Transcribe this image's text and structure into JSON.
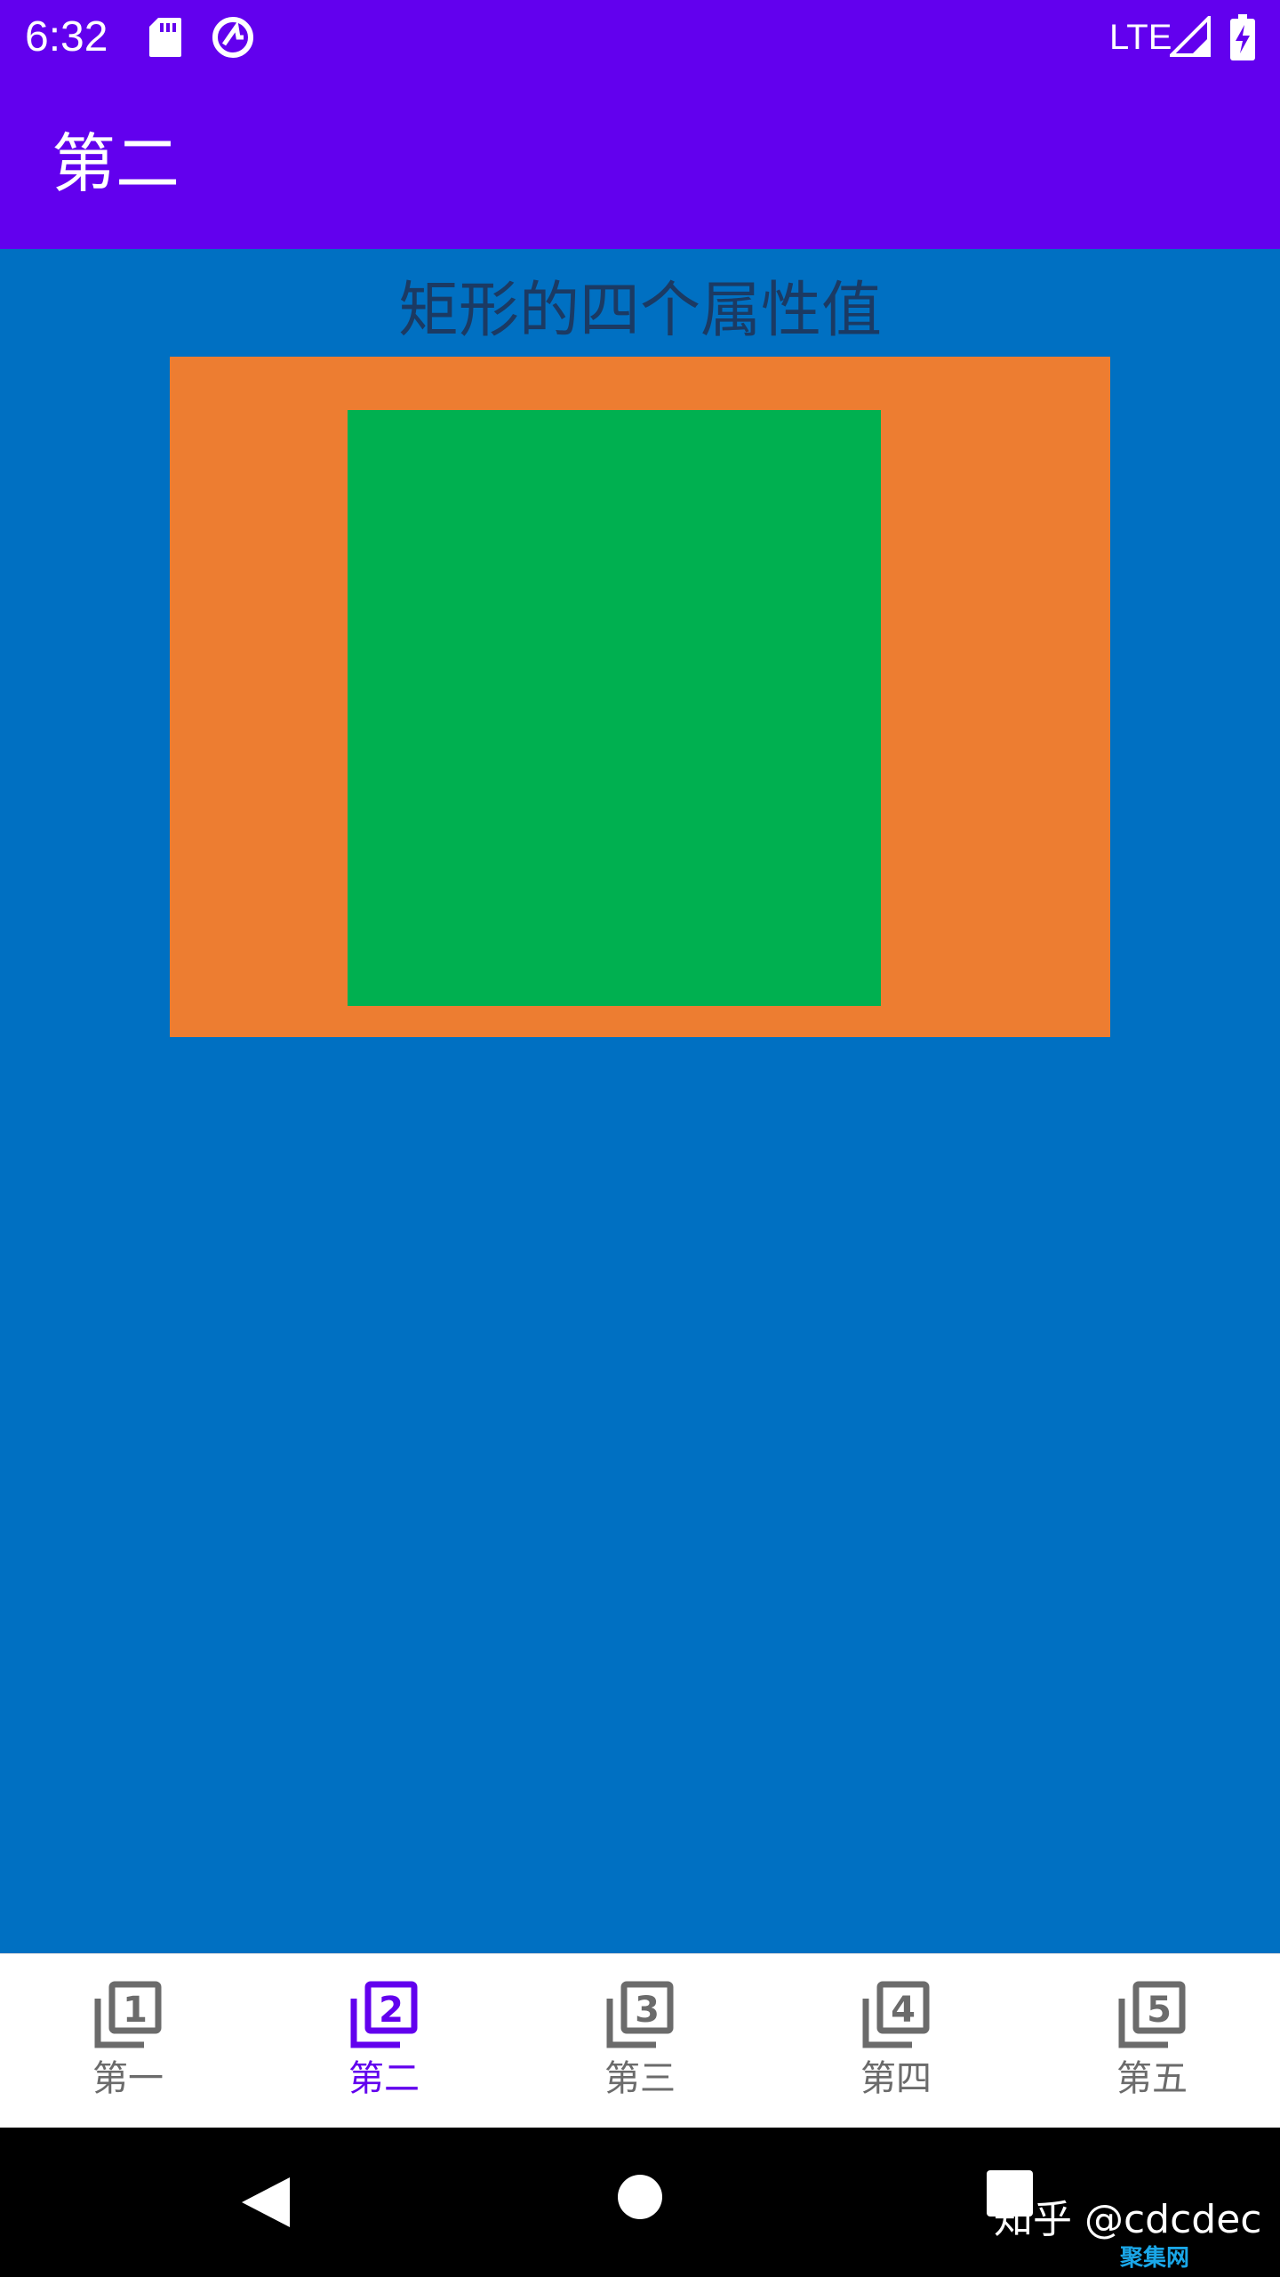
{
  "status_bar": {
    "time": "6:32",
    "network": "LTE",
    "icons": [
      "sd-card-icon",
      "sync-icon",
      "signal-icon",
      "battery-charging-icon"
    ]
  },
  "app_bar": {
    "title": "第二"
  },
  "content": {
    "heading": "矩形的四个属性值",
    "colors": {
      "background": "#0070C2",
      "outer_rect": "#ED7D31",
      "inner_rect": "#00B050"
    }
  },
  "bottom_nav": {
    "active_index": 1,
    "active_color": "#6200EE",
    "inactive_color": "#6B6B6B",
    "items": [
      {
        "label": "第一",
        "icon": "filter-1-icon",
        "number": "1"
      },
      {
        "label": "第二",
        "icon": "filter-2-icon",
        "number": "2"
      },
      {
        "label": "第三",
        "icon": "filter-3-icon",
        "number": "3"
      },
      {
        "label": "第四",
        "icon": "filter-4-icon",
        "number": "4"
      },
      {
        "label": "第五",
        "icon": "filter-5-icon",
        "number": "5"
      }
    ]
  },
  "system_nav": {
    "icons": [
      "back-icon",
      "home-icon",
      "recents-icon"
    ],
    "watermark": "知乎 @cdcdec",
    "watermark_sub": "聚集网"
  }
}
